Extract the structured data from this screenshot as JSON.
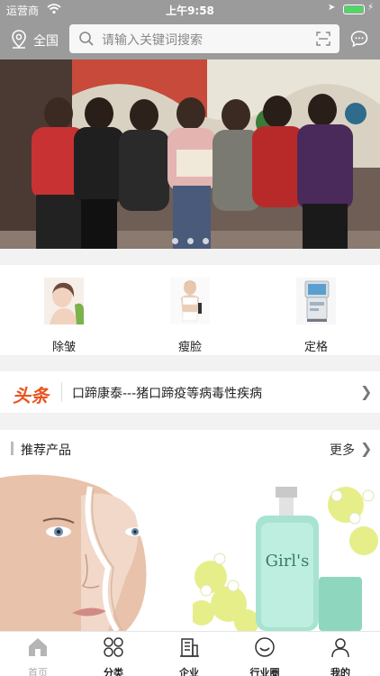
{
  "status_bar": {
    "carrier": "运营商",
    "time": "上午9:58"
  },
  "header": {
    "location_label": "全国",
    "search_placeholder": "请输入关键词搜索"
  },
  "banner": {
    "page_count": 3,
    "active_index": 0
  },
  "categories": [
    {
      "label": "除皱",
      "icon": "wrinkle-removal-icon"
    },
    {
      "label": "瘦脸",
      "icon": "face-slimming-icon"
    },
    {
      "label": "定格",
      "icon": "device-icon"
    }
  ],
  "headline": {
    "tag": "头条",
    "text": "口蹄康泰---猪口蹄疫等病毒性疾病"
  },
  "recommend": {
    "title": "推荐产品",
    "more": "更多"
  },
  "products": [
    {
      "name": "face-peel"
    },
    {
      "name": "bottle-label",
      "label": "Girl's"
    }
  ],
  "tabbar": [
    {
      "label": "首页",
      "icon": "home-icon",
      "active": true
    },
    {
      "label": "分类",
      "icon": "category-icon",
      "active": false
    },
    {
      "label": "企业",
      "icon": "building-icon",
      "active": false
    },
    {
      "label": "行业圈",
      "icon": "smile-circle-icon",
      "active": false
    },
    {
      "label": "我的",
      "icon": "user-icon",
      "active": false
    }
  ],
  "colors": {
    "header_bg": "#9b9b9b",
    "headline_tag": "#e8541e",
    "battery": "#4cd964",
    "active_tab": "#aaaaaa"
  }
}
